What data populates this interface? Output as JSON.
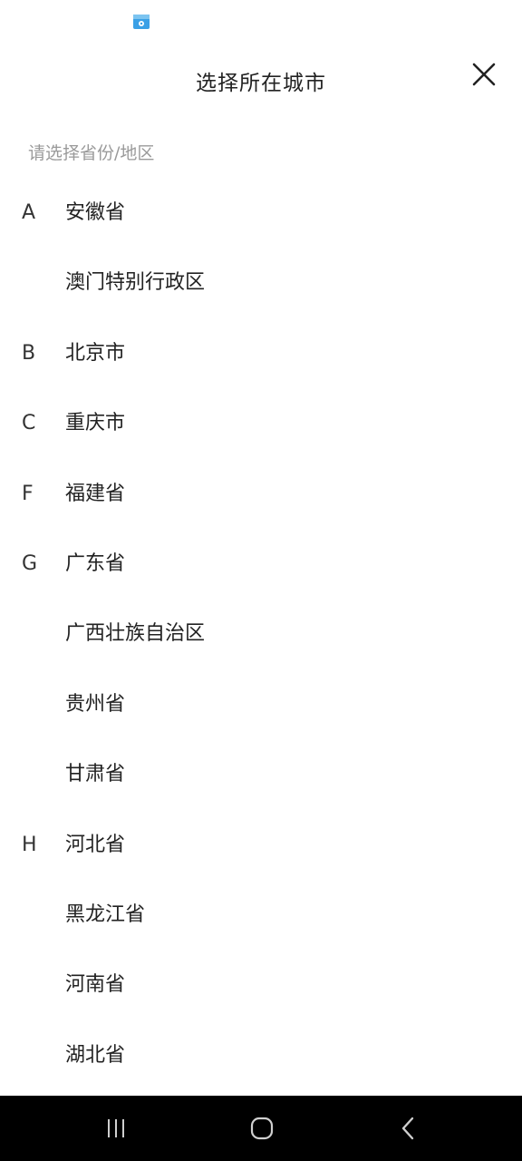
{
  "header": {
    "title": "选择所在城市"
  },
  "subheading": "请选择省份/地区",
  "provinces": [
    {
      "letter": "A",
      "name": "安徽省"
    },
    {
      "letter": "",
      "name": "澳门特别行政区"
    },
    {
      "letter": "B",
      "name": "北京市"
    },
    {
      "letter": "C",
      "name": "重庆市"
    },
    {
      "letter": "F",
      "name": "福建省"
    },
    {
      "letter": "G",
      "name": "广东省"
    },
    {
      "letter": "",
      "name": "广西壮族自治区"
    },
    {
      "letter": "",
      "name": "贵州省"
    },
    {
      "letter": "",
      "name": "甘肃省"
    },
    {
      "letter": "H",
      "name": "河北省"
    },
    {
      "letter": "",
      "name": "黑龙江省"
    },
    {
      "letter": "",
      "name": "河南省"
    },
    {
      "letter": "",
      "name": "湖北省"
    }
  ],
  "icons": {
    "status_app": "app-shop-icon",
    "close": "close-icon",
    "nav_recents": "recents-icon",
    "nav_home": "home-icon",
    "nav_back": "back-icon"
  },
  "colors": {
    "accent": "#3aa0e6",
    "nav_bg": "#000000"
  }
}
